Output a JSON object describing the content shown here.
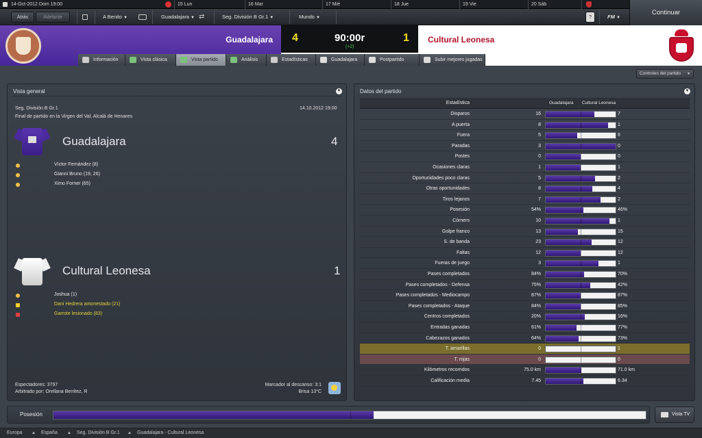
{
  "datebar": {
    "current": "14-Oct-2012  Dom  19:00",
    "days": [
      "15 Lun",
      "16 Mar",
      "17 Mié",
      "18 Jue",
      "19 Vie",
      "20 Sáb"
    ]
  },
  "toolbar": {
    "back": "Atrás",
    "forward": "Adelante",
    "manager": "A Benito",
    "club": "Guadalajara",
    "competition": "Seg. División B Gr.1",
    "world": "Mundo",
    "help": "?",
    "fm": "FM",
    "continue": "Continuar"
  },
  "header": {
    "home_team": "Guadalajara",
    "home_score": "4",
    "time": "90:00r",
    "added": "(+2)",
    "away_score": "1",
    "away_team": "Cultural Leonesa",
    "home_color": "#4a2a9c",
    "away_color": "#c8102e"
  },
  "tabs": [
    {
      "label": "Información",
      "icon": "info-icon"
    },
    {
      "label": "Vista clásica",
      "icon": "classic-view-icon"
    },
    {
      "label": "Vista partido",
      "icon": "match-view-icon"
    },
    {
      "label": "Análisis",
      "icon": "analysis-icon"
    },
    {
      "label": "Estadísticas",
      "icon": "stats-icon"
    },
    {
      "label": "Guadalajara",
      "icon": "team-icon"
    },
    {
      "label": "Postpartido",
      "icon": "postmatch-icon"
    },
    {
      "label": "Subir mejores jugadas",
      "icon": "upload-icon"
    }
  ],
  "controls": "Controles del partido",
  "overview": {
    "title": "Vista general",
    "competition": "Seg. División B Gr.1",
    "date": "14.10.2012 19:00",
    "venue": "Final de partido en la Virgen del Val, Alcalá de Henares",
    "home": {
      "name": "Guadalajara",
      "score": "4",
      "events": [
        "Víctor Fernández (8)",
        "Gianni Bruno (19, 26)",
        "Ximo Forner (65)"
      ]
    },
    "away": {
      "name": "Cultural Leonesa",
      "score": "1",
      "events": [
        "Joshua (1)",
        "Dani Hedrera amonestado (21)",
        "Garrote lesionado (83)"
      ]
    },
    "spectators": "Espectadores: 3797",
    "referee": "Arbitrado por: Orellana Benítez, R",
    "halftime": "Marcador al descanso: 3:1",
    "weather": "Brisa 13°C"
  },
  "stats": {
    "title": "Datos del partido",
    "header": {
      "label": "Estadística",
      "home": "Guadalajara",
      "away": "Cultural Leonesa"
    },
    "rows": [
      {
        "label": "Disparos",
        "home": "16",
        "away": "7",
        "share": 0.7
      },
      {
        "label": "A puerta",
        "home": "8",
        "away": "1",
        "share": 0.89
      },
      {
        "label": "Fuera",
        "home": "5",
        "away": "6",
        "share": 0.45
      },
      {
        "label": "Paradas",
        "home": "3",
        "away": "0",
        "share": 1.0
      },
      {
        "label": "Postes",
        "home": "0",
        "away": "0",
        "share": 0.5
      },
      {
        "label": "Ocasiones claras",
        "home": "1",
        "away": "1",
        "share": 0.5
      },
      {
        "label": "Oportunidades poco claras",
        "home": "5",
        "away": "2",
        "share": 0.71
      },
      {
        "label": "Otras oportunidades",
        "home": "8",
        "away": "4",
        "share": 0.67
      },
      {
        "label": "Tiros lejanos",
        "home": "7",
        "away": "2",
        "share": 0.78
      },
      {
        "label": "Posesión",
        "home": "54%",
        "away": "46%",
        "share": 0.54
      },
      {
        "label": "Córners",
        "home": "10",
        "away": "1",
        "share": 0.91
      },
      {
        "label": "Golpe franco",
        "home": "13",
        "away": "15",
        "share": 0.46
      },
      {
        "label": "S. de banda",
        "home": "23",
        "away": "12",
        "share": 0.66
      },
      {
        "label": "Faltas",
        "home": "12",
        "away": "12",
        "share": 0.5
      },
      {
        "label": "Fueras de juego",
        "home": "3",
        "away": "1",
        "share": 0.75
      },
      {
        "label": "Pases completados",
        "home": "84%",
        "away": "70%",
        "share": 0.55
      },
      {
        "label": "Pases completados - Defensa",
        "home": "75%",
        "away": "42%",
        "share": 0.64
      },
      {
        "label": "Pases completados - Mediocampo",
        "home": "87%",
        "away": "87%",
        "share": 0.5
      },
      {
        "label": "Pases completados - Ataque",
        "home": "84%",
        "away": "85%",
        "share": 0.5
      },
      {
        "label": "Centros completados",
        "home": "20%",
        "away": "16%",
        "share": 0.56
      },
      {
        "label": "Entradas ganadas",
        "home": "61%",
        "away": "77%",
        "share": 0.44
      },
      {
        "label": "Cabezazos ganados",
        "home": "64%",
        "away": "73%",
        "share": 0.47
      },
      {
        "label": "T. amarillas",
        "home": "0",
        "away": "1",
        "share": 0.0,
        "highlight": "#7b6e2c"
      },
      {
        "label": "T. rojas",
        "home": "0",
        "away": "0",
        "share": 0.0,
        "highlight": "#6b4a4e"
      },
      {
        "label": "Kilómetros recorridos",
        "home": "75.0 km",
        "away": "71.0 km",
        "share": 0.51
      },
      {
        "label": "Calificación media",
        "home": "7.45",
        "away": "6.34",
        "share": 0.54
      }
    ]
  },
  "possession": {
    "label": "Posesión",
    "home_share": 0.54
  },
  "vista_tv": "Vista TV",
  "breadcrumbs": [
    "Europa",
    "España",
    "Seg. División B Gr.1",
    "Guadalajara - Cultural Leonesa"
  ]
}
